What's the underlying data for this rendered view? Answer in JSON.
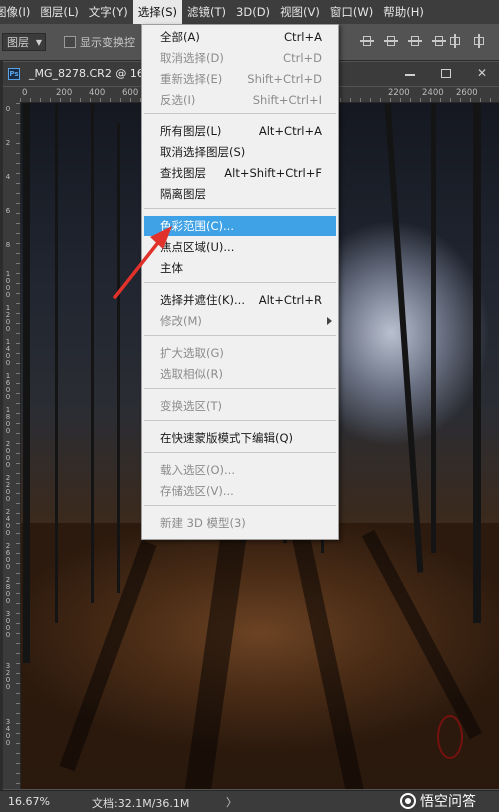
{
  "menubar": {
    "items": [
      {
        "label": "图像(I)"
      },
      {
        "label": "图层(L)"
      },
      {
        "label": "文字(Y)"
      },
      {
        "label": "选择(S)"
      },
      {
        "label": "滤镜(T)"
      },
      {
        "label": "3D(D)"
      },
      {
        "label": "视图(V)"
      },
      {
        "label": "窗口(W)"
      },
      {
        "label": "帮助(H)"
      }
    ]
  },
  "options_bar": {
    "layer_dropdown": "图层",
    "show_transform_label": "显示变换控"
  },
  "document": {
    "title": "_MG_8278.CR2 @ 16."
  },
  "rulers": {
    "top_labels": [
      "0",
      "200",
      "400",
      "600",
      "2200",
      "2400",
      "2600"
    ],
    "left_labels": [
      "0",
      "2",
      "4",
      "6",
      "8",
      "1000",
      "1200",
      "1400",
      "1600",
      "1800",
      "2000",
      "2200",
      "2400",
      "2600",
      "2800",
      "3000",
      "3200",
      "3400"
    ]
  },
  "status_bar": {
    "zoom": "16.67%",
    "doc_info": "文档:32.1M/36.1M",
    "arrow": "〉"
  },
  "watermark": {
    "text": "悟空问答"
  },
  "select_menu": {
    "items": [
      {
        "label": "全部(A)",
        "shortcut": "Ctrl+A",
        "disabled": false
      },
      {
        "label": "取消选择(D)",
        "shortcut": "Ctrl+D",
        "disabled": true
      },
      {
        "label": "重新选择(E)",
        "shortcut": "Shift+Ctrl+D",
        "disabled": true
      },
      {
        "label": "反选(I)",
        "shortcut": "Shift+Ctrl+I",
        "disabled": true
      },
      {
        "label": "所有图层(L)",
        "shortcut": "Alt+Ctrl+A",
        "disabled": false
      },
      {
        "label": "取消选择图层(S)",
        "shortcut": "",
        "disabled": false
      },
      {
        "label": "查找图层",
        "shortcut": "Alt+Shift+Ctrl+F",
        "disabled": false
      },
      {
        "label": "隔离图层",
        "shortcut": "",
        "disabled": false
      },
      {
        "label": "色彩范围(C)...",
        "shortcut": "",
        "disabled": false,
        "highlighted": true
      },
      {
        "label": "焦点区域(U)...",
        "shortcut": "",
        "disabled": false
      },
      {
        "label": "主体",
        "shortcut": "",
        "disabled": false
      },
      {
        "label": "选择并遮住(K)...",
        "shortcut": "Alt+Ctrl+R",
        "disabled": false
      },
      {
        "label": "修改(M)",
        "shortcut": "",
        "disabled": true,
        "submenu": true
      },
      {
        "label": "扩大选取(G)",
        "shortcut": "",
        "disabled": true
      },
      {
        "label": "选取相似(R)",
        "shortcut": "",
        "disabled": true
      },
      {
        "label": "变换选区(T)",
        "shortcut": "",
        "disabled": true
      },
      {
        "label": "在快速蒙版模式下编辑(Q)",
        "shortcut": "",
        "disabled": false
      },
      {
        "label": "载入选区(O)...",
        "shortcut": "",
        "disabled": true
      },
      {
        "label": "存储选区(V)...",
        "shortcut": "",
        "disabled": true
      },
      {
        "label": "新建 3D 模型(3)",
        "shortcut": "",
        "disabled": true
      }
    ]
  },
  "colors": {
    "menu_highlight": "#3fa2e6",
    "annotation_arrow": "#e0312b",
    "app_background": "#535353"
  }
}
